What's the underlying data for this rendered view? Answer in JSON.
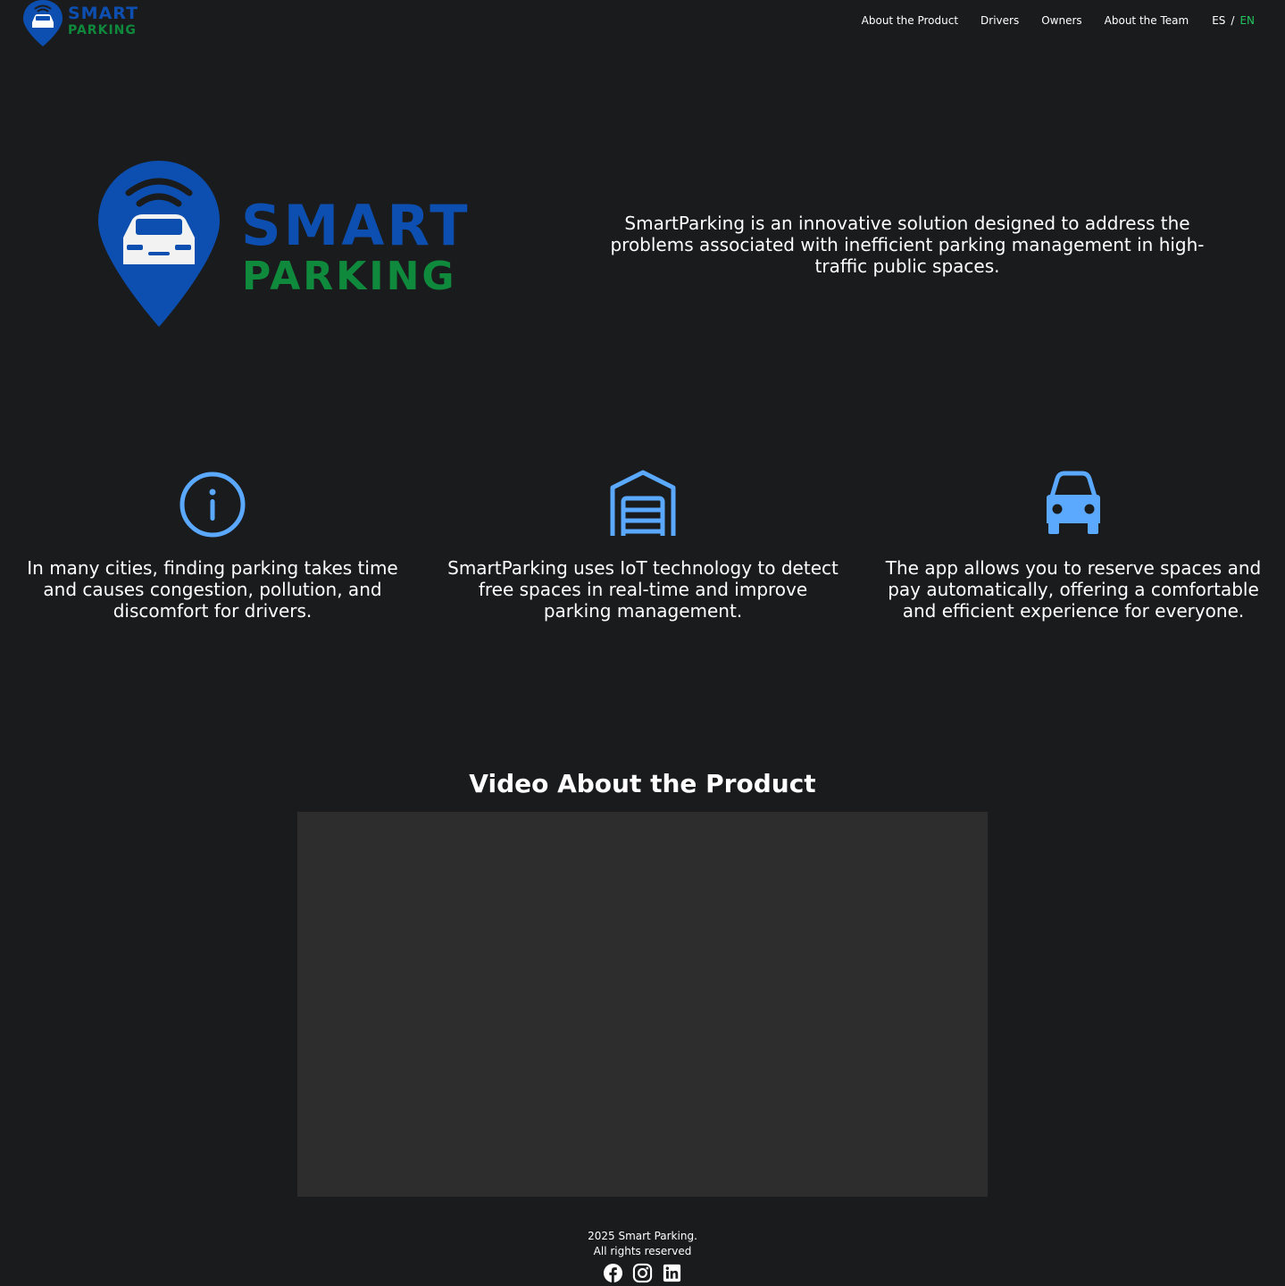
{
  "header": {
    "logo_word1": "SMART",
    "logo_word2": "PARKING",
    "nav": [
      {
        "label": "About the Product"
      },
      {
        "label": "Drivers"
      },
      {
        "label": "Owners"
      },
      {
        "label": "About the Team"
      }
    ],
    "lang": {
      "es": "ES",
      "sep": "/",
      "en": "EN",
      "active": "EN"
    }
  },
  "hero": {
    "logo_word1": "SMART",
    "logo_word2": "PARKING",
    "description": "SmartParking is an innovative solution designed to address the problems associated with inefficient parking management in high-traffic public spaces."
  },
  "features": [
    {
      "icon": "info-icon",
      "text": "In many cities, finding parking takes time and causes congestion, pollution, and discomfort for drivers."
    },
    {
      "icon": "garage-icon",
      "text": "SmartParking uses IoT technology to detect free spaces in real-time and improve parking management."
    },
    {
      "icon": "car-icon",
      "text": "The app allows you to reserve spaces and pay automatically, offering a comfortable and efficient experience for everyone."
    }
  ],
  "video": {
    "title": "Video About the Product"
  },
  "footer": {
    "copyright": "2025 Smart Parking.",
    "rights": "All rights reserved",
    "socials": [
      "facebook-icon",
      "instagram-icon",
      "linkedin-icon"
    ]
  },
  "colors": {
    "background": "#1a1b1d",
    "brand_blue": "#0d4fb0",
    "brand_green": "#0f8a3c",
    "icon_blue": "#5aa9ff",
    "active_lang": "#22c55e",
    "video_bg": "#2d2d2d"
  }
}
